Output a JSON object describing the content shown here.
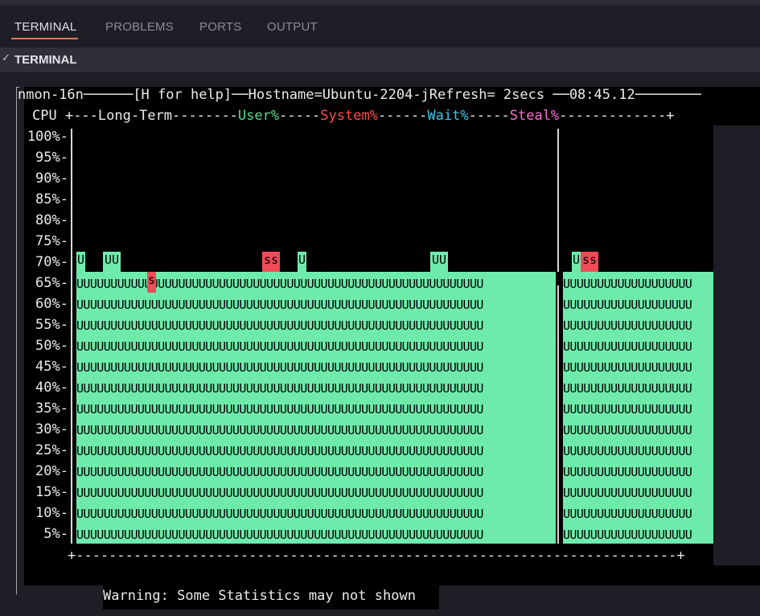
{
  "tabs": [
    {
      "label": "TERMINAL",
      "active": true
    },
    {
      "label": "PROBLEMS",
      "active": false
    },
    {
      "label": "PORTS",
      "active": false
    },
    {
      "label": "OUTPUT",
      "active": false
    }
  ],
  "section": {
    "title": "TERMINAL",
    "icon": "chevron-down-icon"
  },
  "nmon": {
    "title_prefix": "nmon-16n",
    "help": "[H for help]",
    "hostname": "Hostname=Ubuntu-2204-j",
    "refresh": "Refresh= 2secs",
    "time": "08:45.12",
    "cpu_label": "CPU",
    "long_term": "Long-Term",
    "legend": {
      "user": "User%",
      "system": "System%",
      "wait": "Wait%",
      "steal": "Steal%"
    },
    "y_labels": [
      "100%-",
      "95%-",
      "90%-",
      "85%-",
      "80%-",
      "75%-",
      "70%-",
      "65%-",
      "60%-",
      "55%-",
      "50%-",
      "45%-",
      "40%-",
      "35%-",
      "30%-",
      "25%-",
      "20%-",
      "15%-",
      "10%-",
      "5%-"
    ],
    "fill_char": "U",
    "system_char": "s",
    "warning": "Warning: Some Statistics may not shown"
  },
  "colors": {
    "user": "#6eebab",
    "system": "#f04b57",
    "wait": "#36c9e8",
    "steal": "#ff6bd3",
    "accent": "#e07a55"
  }
}
